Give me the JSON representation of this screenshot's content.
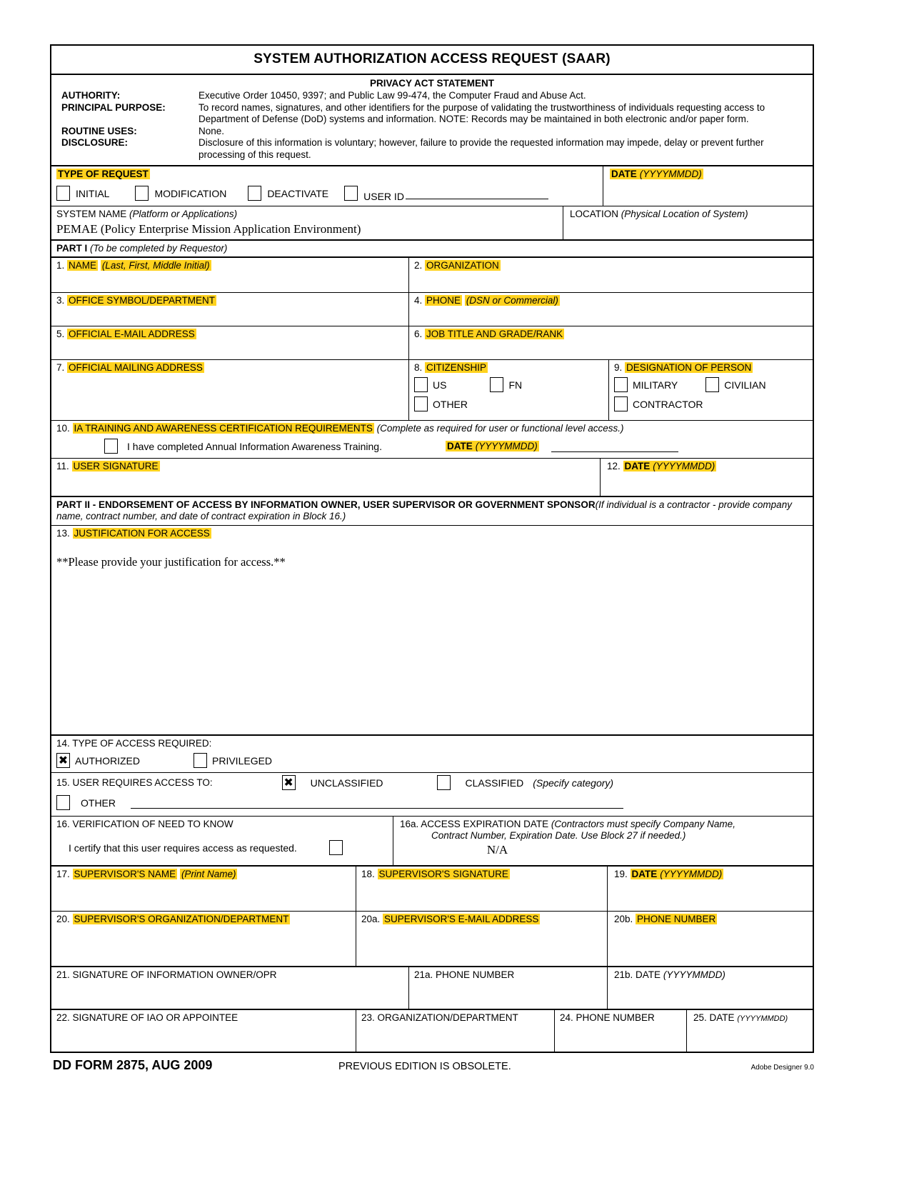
{
  "form": {
    "title": "SYSTEM AUTHORIZATION ACCESS REQUEST (SAAR)",
    "privacy": {
      "heading": "PRIVACY ACT STATEMENT",
      "rows": [
        {
          "label": "AUTHORITY:",
          "text": "Executive Order 10450, 9397; and Public Law 99-474, the Computer Fraud and Abuse Act."
        },
        {
          "label": "PRINCIPAL PURPOSE:",
          "text": "To record names, signatures, and other identifiers for the purpose of validating the trustworthiness of individuals requesting access to Department of Defense (DoD) systems and information.  NOTE:  Records may be maintained in both electronic and/or paper form."
        },
        {
          "label": "ROUTINE USES:",
          "text": "None."
        },
        {
          "label": "DISCLOSURE:",
          "text": "Disclosure of this information is voluntary; however, failure to provide the requested information may impede, delay or prevent further processing of this request."
        }
      ]
    },
    "type_of_request": {
      "label": "TYPE OF REQUEST",
      "options": [
        "INITIAL",
        "MODIFICATION",
        "DEACTIVATE"
      ],
      "user_id_label": "USER ID",
      "user_id_value": "",
      "date_label": "DATE",
      "date_format": "(YYYYMMDD)",
      "date_value": ""
    },
    "system_name": {
      "label": "SYSTEM NAME",
      "hint": "(Platform or Applications)",
      "value": "PEMAE (Policy Enterprise Mission Application Environment)"
    },
    "location": {
      "label": "LOCATION",
      "hint": "(Physical Location of System)",
      "value": ""
    },
    "part1": {
      "heading": "PART I",
      "heading_hint": "(To be completed by Requestor)",
      "blocks": {
        "b1": {
          "num": "1.",
          "label": "NAME",
          "hint": "(Last, First, Middle Initial)",
          "value": ""
        },
        "b2": {
          "num": "2.",
          "label": "ORGANIZATION",
          "hint": "",
          "value": ""
        },
        "b3": {
          "num": "3.",
          "label": "OFFICE SYMBOL/DEPARTMENT",
          "hint": "",
          "value": ""
        },
        "b4": {
          "num": "4.",
          "label": "PHONE",
          "hint": "(DSN or Commercial)",
          "value": ""
        },
        "b5": {
          "num": "5.",
          "label": "OFFICIAL E-MAIL ADDRESS",
          "hint": "",
          "value": ""
        },
        "b6": {
          "num": "6.",
          "label": "JOB TITLE AND GRADE/RANK",
          "hint": "",
          "value": ""
        },
        "b7": {
          "num": "7.",
          "label": "OFFICIAL MAILING ADDRESS",
          "hint": "",
          "value": ""
        },
        "b8": {
          "num": "8.",
          "label": "CITIZENSHIP",
          "options": [
            "US",
            "FN",
            "OTHER"
          ]
        },
        "b9": {
          "num": "9.",
          "label": "DESIGNATION OF PERSON",
          "options": [
            "MILITARY",
            "CIVILIAN",
            "CONTRACTOR"
          ]
        },
        "b10": {
          "num": "10.",
          "label": "IA TRAINING AND AWARENESS CERTIFICATION REQUIREMENTS",
          "hint": "(Complete as required for user or functional level access.)",
          "checkbox_text": "I have completed Annual Information Awareness Training.",
          "date_label": "DATE",
          "date_format": "(YYYYMMDD)",
          "date_value": ""
        },
        "b11": {
          "num": "11.",
          "label": "USER SIGNATURE",
          "value": ""
        },
        "b12": {
          "num": "12.",
          "label": "DATE",
          "hint": "(YYYYMMDD)",
          "value": ""
        }
      }
    },
    "part2": {
      "heading": "PART II - ENDORSEMENT OF ACCESS BY INFORMATION OWNER, USER SUPERVISOR OR GOVERNMENT SPONSOR",
      "heading_hint": "(If individual is a contractor - provide company name, contract number, and date of contract expiration in Block 16.)",
      "blocks": {
        "b13": {
          "num": "13.",
          "label": "JUSTIFICATION FOR ACCESS",
          "value": "**Please provide your justification for access.**"
        },
        "b14": {
          "num": "14.",
          "label": "TYPE OF ACCESS REQUIRED:",
          "options": [
            {
              "text": "AUTHORIZED",
              "checked": true
            },
            {
              "text": "PRIVILEGED",
              "checked": false
            }
          ]
        },
        "b15": {
          "num": "15.",
          "label": "USER REQUIRES ACCESS TO:",
          "options": [
            {
              "text": "UNCLASSIFIED",
              "hint": "",
              "checked": true
            },
            {
              "text": "CLASSIFIED",
              "hint": "(Specify category)",
              "checked": false
            },
            {
              "text": "OTHER",
              "hint": "",
              "checked": false
            }
          ],
          "other_value": ""
        },
        "b16": {
          "num": "16.",
          "label": "VERIFICATION OF NEED TO KNOW",
          "certify_text": "I certify that this user requires access as requested.",
          "checked": false
        },
        "b16a": {
          "num": "16a.",
          "label": "ACCESS EXPIRATION DATE",
          "hint_line1": "(Contractors must specify Company Name,",
          "hint_line2": "Contract Number, Expiration Date.  Use Block 27 if needed.)",
          "value": "N/A"
        },
        "b17": {
          "num": "17.",
          "label": "SUPERVISOR'S NAME",
          "hint": "(Print Name)",
          "value": ""
        },
        "b18": {
          "num": "18.",
          "label": "SUPERVISOR'S SIGNATURE",
          "hint": "",
          "value": ""
        },
        "b19": {
          "num": "19.",
          "label": "DATE",
          "hint": "(YYYYMMDD)",
          "value": ""
        },
        "b20": {
          "num": "20.",
          "label": "SUPERVISOR'S ORGANIZATION/DEPARTMENT",
          "hint": "",
          "value": ""
        },
        "b20a": {
          "num": "20a.",
          "label": "SUPERVISOR'S E-MAIL ADDRESS",
          "hint": "",
          "value": ""
        },
        "b20b": {
          "num": "20b.",
          "label": "PHONE NUMBER",
          "hint": "",
          "value": ""
        },
        "b21": {
          "num": "21.",
          "label": "SIGNATURE OF INFORMATION OWNER/OPR",
          "hint": "",
          "value": ""
        },
        "b21a": {
          "num": "21a.",
          "label": "PHONE NUMBER",
          "hint": "",
          "value": ""
        },
        "b21b": {
          "num": "21b.",
          "label": "DATE",
          "hint": "(YYYYMMDD)",
          "value": ""
        },
        "b22": {
          "num": "22.",
          "label": "SIGNATURE OF IAO OR APPOINTEE",
          "hint": "",
          "value": ""
        },
        "b23": {
          "num": "23.",
          "label": "ORGANIZATION/DEPARTMENT",
          "hint": "",
          "value": ""
        },
        "b24": {
          "num": "24.",
          "label": "PHONE NUMBER",
          "hint": "",
          "value": ""
        },
        "b25": {
          "num": "25.",
          "label": "DATE",
          "hint": "(YYYYMMDD)",
          "value": ""
        }
      }
    },
    "footer": {
      "form_id": "DD FORM 2875, AUG 2009",
      "edition": "PREVIOUS EDITION IS OBSOLETE.",
      "producer": "Adobe Designer 9.0"
    }
  }
}
